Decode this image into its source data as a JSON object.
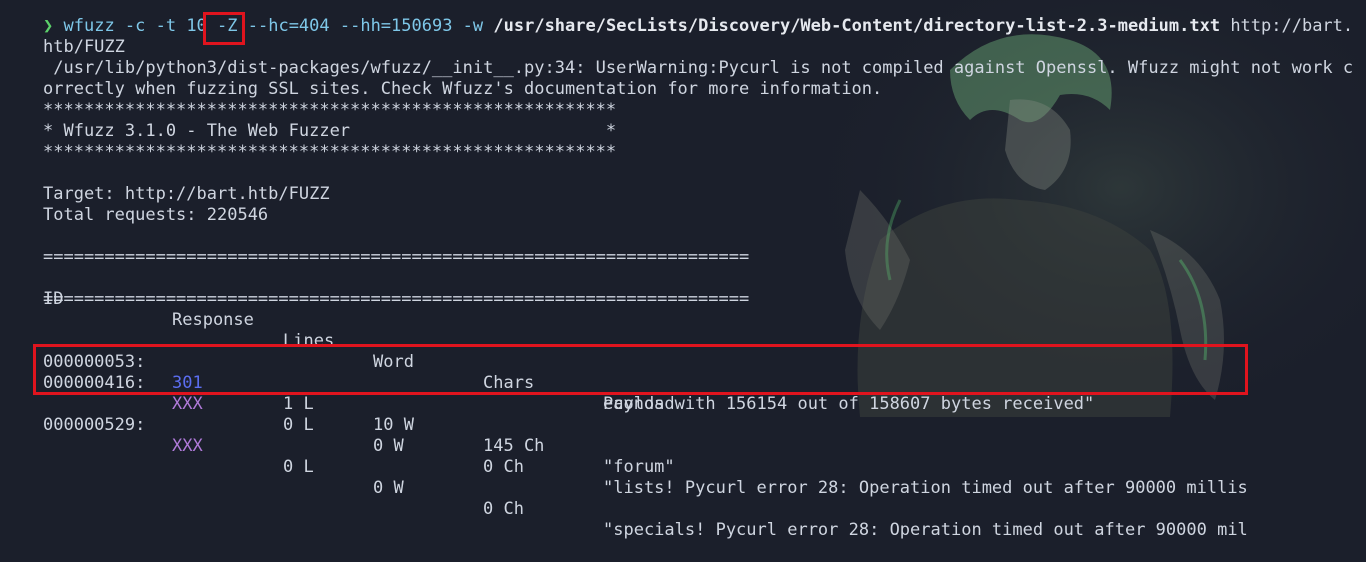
{
  "command": {
    "prompt_symbol": "❯",
    "part1": "wfuzz -c -t 10 ",
    "flag_z": "-Z",
    "part2": " --hc=404 --hh=150693 -w ",
    "wordlist": "/usr/share/SecLists/Discovery/Web-Content/directory-list-2.3-medium.txt",
    "url_part1": " http://bart.",
    "url_part2": "htb/FUZZ"
  },
  "warning": {
    "line1": " /usr/lib/python3/dist-packages/wfuzz/__init__.py:34: UserWarning:Pycurl is not compiled against Openssl. Wfuzz might not work c",
    "line2": "orrectly when fuzzing SSL sites. Check Wfuzz's documentation for more information."
  },
  "banner": {
    "stars": "********************************************************",
    "title": "* Wfuzz 3.1.0 - The Web Fuzzer                         *"
  },
  "target": "Target: http://bart.htb/FUZZ",
  "total": "Total requests: 220546",
  "separator": "=====================================================================",
  "columns": [
    "ID",
    "Response",
    "Lines",
    "Word",
    "Chars",
    "Payload"
  ],
  "rows": [
    {
      "id": "000000053:",
      "response": "301",
      "lines": "1 L",
      "word": "10 W",
      "chars": "145 Ch",
      "payload": "\"forum\"",
      "payload2": ""
    },
    {
      "id": "000000416:",
      "response": "XXX",
      "lines": "0 L",
      "word": "0 W",
      "chars": "0 Ch",
      "payload": "\"lists! Pycurl error 28: Operation timed out after 90000 millis",
      "payload2": "econds with 156154 out of 158607 bytes received\""
    },
    {
      "id": "000000529:",
      "response": "XXX",
      "lines": "0 L",
      "word": "0 W",
      "chars": "0 Ch",
      "payload": "\"specials! Pycurl error 28: Operation timed out after 90000 mil",
      "payload2": ""
    }
  ],
  "colors": {
    "highlight": "#e0141e",
    "prompt": "#5bd16a",
    "command": "#7ec7e8",
    "code_301": "#5b6df0",
    "code_xxx": "#b07ad9"
  }
}
